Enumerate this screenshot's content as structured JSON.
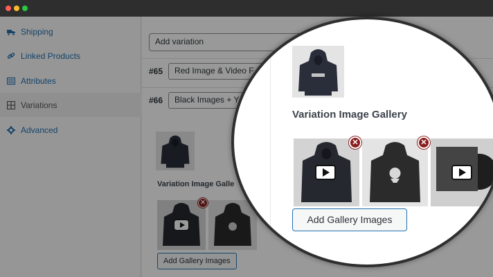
{
  "window": {
    "traffic_lights": [
      "close",
      "minimize",
      "maximize"
    ]
  },
  "sidebar": {
    "items": [
      {
        "label": "Shipping",
        "icon": "truck-icon"
      },
      {
        "label": "Linked Products",
        "icon": "link-icon"
      },
      {
        "label": "Attributes",
        "icon": "list-icon"
      },
      {
        "label": "Variations",
        "icon": "grid-icon",
        "active": true
      },
      {
        "label": "Advanced",
        "icon": "gear-icon"
      }
    ]
  },
  "main": {
    "add_variation": "Add variation",
    "variations": [
      {
        "number": "#65",
        "name": "Red Image & Video F"
      },
      {
        "number": "#66",
        "name": "Black Images + Y"
      }
    ],
    "gallery_label": "Variation Image Galle",
    "add_gallery_button": "Add Gallery Images"
  },
  "zoom": {
    "gallery_label": "Variation Image Gallery",
    "add_gallery_button": "Add Gallery Images",
    "remove_symbol": "✕"
  },
  "colors": {
    "link": "#2271b1",
    "remove": "#8a1f1f",
    "hoodie": "#2a2e3b"
  }
}
